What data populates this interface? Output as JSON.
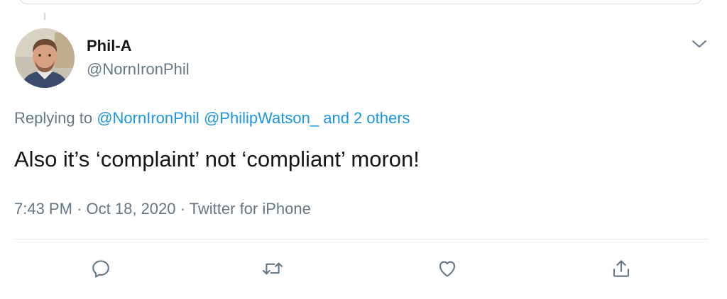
{
  "user": {
    "name": "Phil-A",
    "handle": "@NornIronPhil"
  },
  "reply": {
    "prefix": "Replying to",
    "mentions": [
      "@NornIronPhil",
      "@PhilipWatson_"
    ],
    "others": "and 2 others"
  },
  "tweet": {
    "text": "Also it’s ‘complaint’ not ‘compliant’ moron!"
  },
  "meta": {
    "time": "7:43 PM",
    "separator": "·",
    "date": "Oct 18, 2020",
    "source": "Twitter for iPhone"
  },
  "icons": {
    "caret": "chevron-down-icon",
    "reply": "reply-icon",
    "retweet": "retweet-icon",
    "like": "heart-icon",
    "share": "share-icon"
  },
  "colors": {
    "link": "#1b95e0",
    "secondary_text": "#657786",
    "primary_text": "#14171a",
    "divider": "#e1e8ed"
  }
}
